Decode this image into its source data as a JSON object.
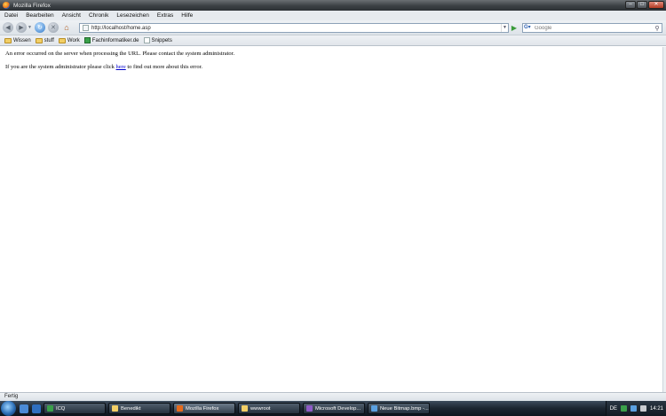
{
  "window": {
    "title": "Mozilla Firefox"
  },
  "menu": [
    "Datei",
    "Bearbeiten",
    "Ansicht",
    "Chronik",
    "Lesezeichen",
    "Extras",
    "Hilfe"
  ],
  "toolbar": {
    "url": "http://localhost/home.asp",
    "search_placeholder": "Google"
  },
  "bookmarks": [
    {
      "label": "Wissen",
      "icon": "folder-icon"
    },
    {
      "label": "stuff",
      "icon": "folder-icon"
    },
    {
      "label": "Work",
      "icon": "folder-icon"
    },
    {
      "label": "Fachinformatiker.de",
      "icon": "site-icon"
    },
    {
      "label": "Snippets",
      "icon": "page-icon"
    }
  ],
  "page": {
    "message1": "An error occurred on the server when processing the URL. Please contact the system administrator.",
    "message2_before": "If you are the system administrator please click ",
    "message2_link": "here",
    "message2_after": " to find out more about this error."
  },
  "status": {
    "text": "Fertig"
  },
  "taskbar": {
    "tasks": [
      {
        "label": "ICQ",
        "color": "#3aa04a"
      },
      {
        "label": "Benedikt",
        "color": "#f2cf66"
      },
      {
        "label": "Mozilla Firefox",
        "color": "#e56a1c",
        "active": true
      },
      {
        "label": "wwwroot",
        "color": "#f2cf66"
      },
      {
        "label": "Microsoft Develop...",
        "color": "#8e5bc7"
      },
      {
        "label": "Neue Bitmap.bmp -...",
        "color": "#5aa0e0"
      }
    ],
    "language": "DE",
    "clock": "14:21"
  }
}
